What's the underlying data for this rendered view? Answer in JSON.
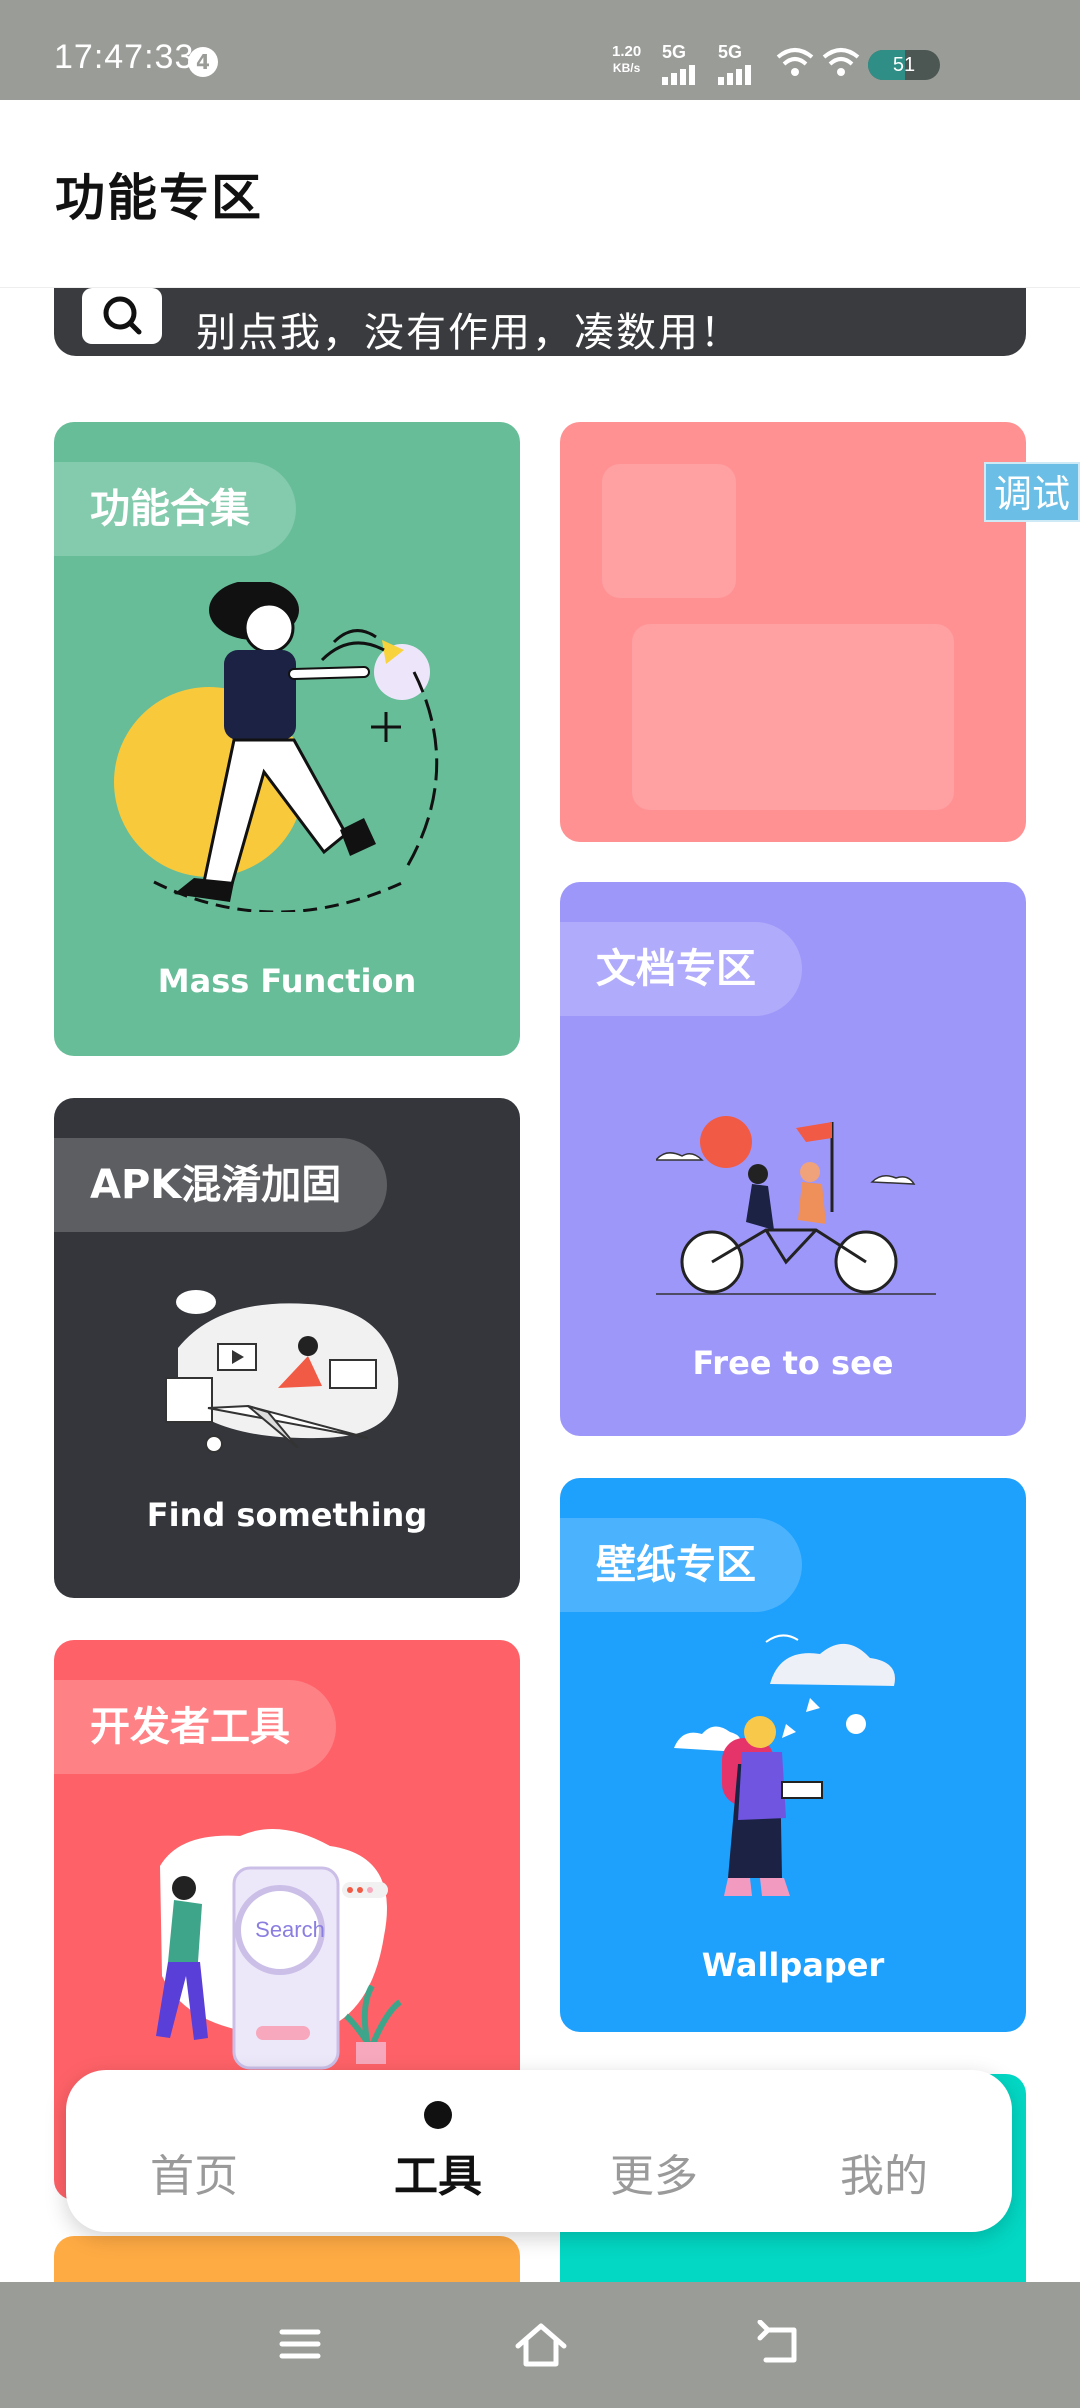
{
  "status_bar": {
    "time": "17:47:33",
    "notification_count": "4",
    "net_speed_value": "1.20",
    "net_speed_unit": "KB/s",
    "sim1": "5G",
    "sim2": "5G",
    "battery": "51",
    "battery_level": 0.51
  },
  "header": {
    "title": "功能专区"
  },
  "search": {
    "text": "别点我，没有作用，凑数用！",
    "icon": "search-icon"
  },
  "cards": {
    "mass": {
      "tag": "功能合集",
      "caption": "Mass Function",
      "color": "#66bd98"
    },
    "pink": {
      "color": "#ff9193"
    },
    "doc": {
      "tag": "文档专区",
      "caption": "Free to see",
      "color": "#9e97fa"
    },
    "apk": {
      "tag": "APK混淆加固",
      "caption": "Find something",
      "color": "#34363b"
    },
    "wallpaper": {
      "tag": "壁纸专区",
      "caption": "Wallpaper",
      "color": "#1ea0fd"
    },
    "dev": {
      "tag": "开发者工具",
      "search_word": "Search",
      "color": "#fe6268"
    },
    "orange": {
      "color": "#ffab44"
    },
    "teal": {
      "color": "#03d8c4"
    }
  },
  "debug_button": "调试",
  "tabs": [
    {
      "label": "首页",
      "active": false
    },
    {
      "label": "工具",
      "active": true
    },
    {
      "label": "更多",
      "active": false
    },
    {
      "label": "我的",
      "active": false
    }
  ],
  "nav": {
    "menu": "menu-icon",
    "home": "home-icon",
    "back": "back-icon"
  }
}
